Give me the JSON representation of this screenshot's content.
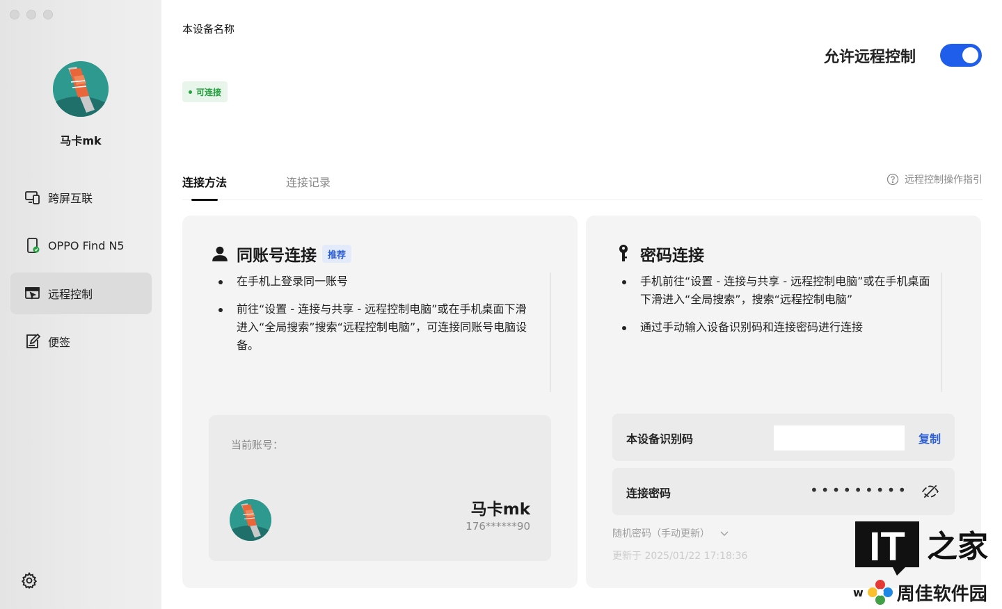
{
  "sidebar": {
    "user_name": "马卡mk",
    "items": [
      {
        "label": "跨屏互联",
        "icon": "screen-link-icon",
        "active": false
      },
      {
        "label": "OPPO Find N5",
        "icon": "phone-connected-icon",
        "active": false
      },
      {
        "label": "远程控制",
        "icon": "remote-control-icon",
        "active": true
      },
      {
        "label": "便签",
        "icon": "notes-icon",
        "active": false
      }
    ],
    "settings_icon": "gear-icon"
  },
  "header": {
    "device_name_label": "本设备名称",
    "status_badge": "可连接",
    "allow_remote_label": "允许远程控制",
    "allow_remote_enabled": true
  },
  "tabs": {
    "items": [
      "连接方法",
      "连接记录"
    ],
    "active": "连接方法",
    "guide_link": "远程控制操作指引"
  },
  "same_account": {
    "title": "同账号连接",
    "badge": "推荐",
    "bullets": [
      "在手机上登录同一账号",
      "前往“设置 - 连接与共享 - 远程控制电脑”或在手机桌面下滑进入“全局搜索”搜索“远程控制电脑”，可连接同账号电脑设备。"
    ],
    "current_account_label": "当前账号：",
    "account_name": "马卡mk",
    "account_phone": "176******90"
  },
  "password_connect": {
    "title": "密码连接",
    "bullets": [
      "手机前往“设置 - 连接与共享 - 远程控制电脑”或在手机桌面下滑进入“全局搜索”，搜索“远程控制电脑”",
      "通过手动输入设备识别码和连接密码进行连接"
    ],
    "device_id_label": "本设备识别码",
    "device_id_value": "",
    "copy_label": "复制",
    "password_label": "连接密码",
    "password_masked": "•••••••••",
    "random_password_label": "随机密码（手动更新）",
    "updated_at": "更新于 2025/01/22 17:18:36"
  },
  "watermark": {
    "it_text": "IT",
    "home_text": "之家",
    "site_text": "周佳软件园",
    "w_text": "w"
  },
  "colors": {
    "accent": "#1e5eea",
    "link": "#2d5fd8",
    "status_green": "#22a33e"
  }
}
